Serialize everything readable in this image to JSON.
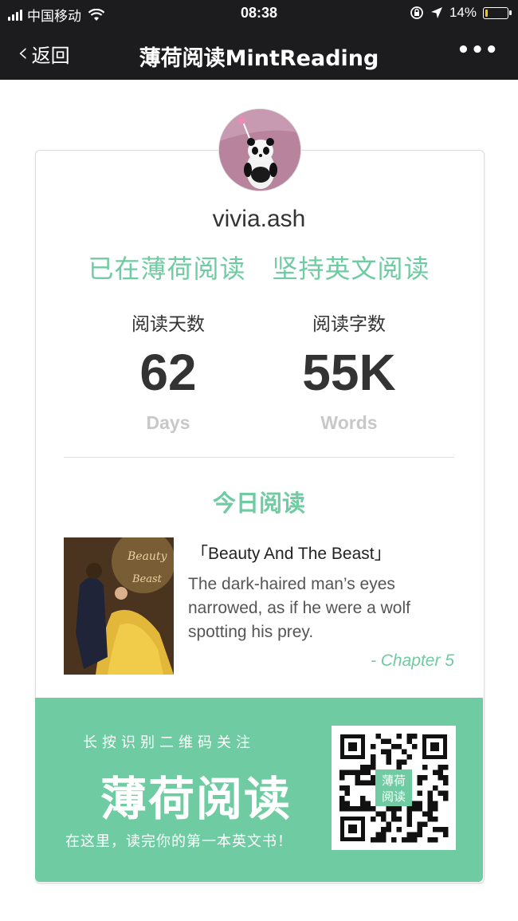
{
  "status_bar": {
    "carrier": "中国移动",
    "time": "08:38",
    "battery": "14%",
    "battery_level": 0.14,
    "icons": [
      "signal-icon",
      "wifi-icon",
      "lock-rotation-icon",
      "location-arrow-icon",
      "battery-icon"
    ]
  },
  "nav": {
    "back_label": "返回",
    "title": "薄荷阅读MintReading",
    "more_label": "•••"
  },
  "profile": {
    "username": "vivia.ash",
    "slogan": "已在薄荷阅读　坚持英文阅读"
  },
  "stats": {
    "days": {
      "label": "阅读天数",
      "value": "62",
      "unit": "Days"
    },
    "words": {
      "label": "阅读字数",
      "value": "55K",
      "unit": "Words"
    }
  },
  "today": {
    "title": "今日阅读",
    "book_title": "「Beauty And The Beast」",
    "excerpt": "The dark-haired man’s eyes narrowed, as if he were a wolf spotting his prey.",
    "chapter": "- Chapter 5"
  },
  "footer": {
    "hint": "长按识别二维码关注",
    "brand": "薄荷阅读",
    "tagline": "在这里，读完你的第一本英文书！",
    "qr_center": "薄荷阅读"
  },
  "colors": {
    "accent": "#6fcba2",
    "nav_bg": "#1c1c1e"
  }
}
